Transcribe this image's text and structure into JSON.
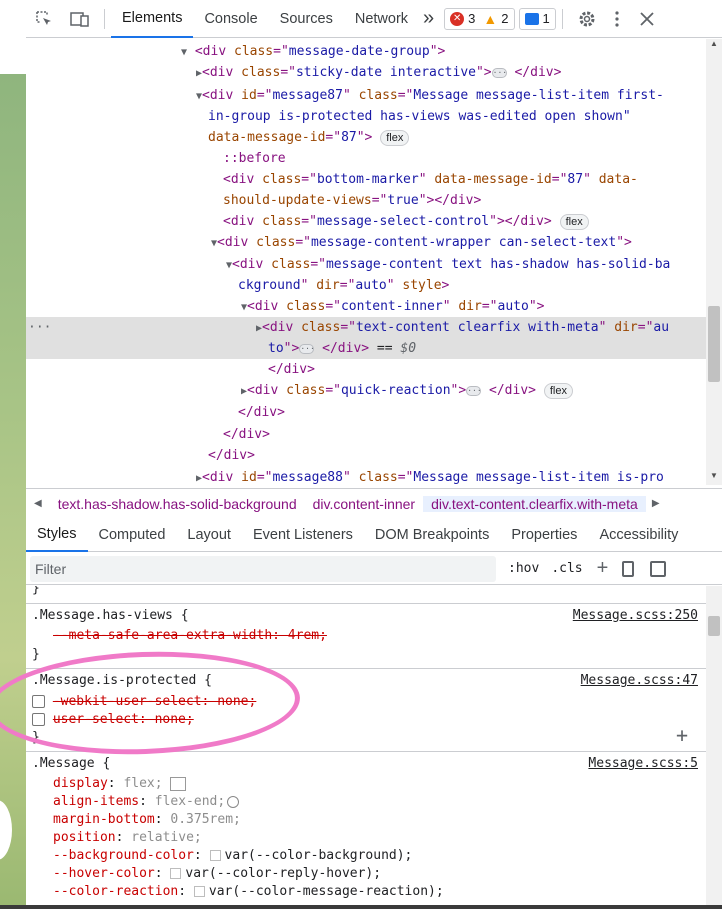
{
  "toolbar": {
    "tabs": [
      "Elements",
      "Console",
      "Sources",
      "Network"
    ],
    "more": "»",
    "errors": "3",
    "warnings": "2",
    "messages": "1"
  },
  "dom": {
    "l1": [
      "<div ",
      "class",
      "=\"",
      "message-date-group",
      "\">"
    ],
    "l2": [
      "<div ",
      "class",
      "=\"",
      "sticky-date interactive",
      "\">",
      "</div>"
    ],
    "l3a": [
      "<div ",
      "id",
      "=\"",
      "message87",
      "\" ",
      "class",
      "=\"",
      "Message message-list-item first-"
    ],
    "l3b": "in-group is-protected has-views was-edited open shown\"",
    "l3c": [
      "data-message-id",
      "=\"",
      "87",
      "\">"
    ],
    "flex": "flex",
    "before": "::before",
    "l5a": [
      "<div ",
      "class",
      "=\"",
      "bottom-marker",
      "\" ",
      "data-message-id",
      "=\"",
      "87",
      "\" ",
      "data-"
    ],
    "l5b": [
      "should-update-views",
      "=\"",
      "true",
      "\">",
      "</div>"
    ],
    "l6": [
      "<div ",
      "class",
      "=\"",
      "message-select-control",
      "\">",
      "</div>"
    ],
    "l7": [
      "<div ",
      "class",
      "=\"",
      "message-content-wrapper can-select-text",
      "\">"
    ],
    "l8a": [
      "<div ",
      "class",
      "=\"",
      "message-content text has-shadow has-solid-ba"
    ],
    "l8b": [
      "ckground",
      "\" ",
      "dir",
      "=\"",
      "auto",
      "\" ",
      "style",
      ">"
    ],
    "l9": [
      "<div ",
      "class",
      "=\"",
      "content-inner",
      "\" ",
      "dir",
      "=\"",
      "auto",
      "\">"
    ],
    "l10a": [
      "<div ",
      "class",
      "=\"",
      "text-content clearfix with-meta",
      "\" ",
      "dir",
      "=\"",
      "au"
    ],
    "l10b": [
      "to",
      "\">",
      "</div>",
      " == ",
      "$0"
    ],
    "close": "</div>",
    "l12": [
      "<div ",
      "class",
      "=\"",
      "quick-reaction",
      "\">",
      "</div>"
    ],
    "l17": [
      "<div ",
      "id",
      "=\"",
      "message88",
      "\" ",
      "class",
      "=\"",
      "Message message-list-item is-pro"
    ]
  },
  "breadcrumbs": [
    "text.has-shadow.has-solid-background",
    "div.content-inner",
    "div.text-content.clearfix.with-meta"
  ],
  "subtabs": [
    "Styles",
    "Computed",
    "Layout",
    "Event Listeners",
    "DOM Breakpoints",
    "Properties",
    "Accessibility"
  ],
  "filter": {
    "placeholder": "Filter",
    "hov": ":hov",
    "cls": ".cls"
  },
  "styles": {
    "brace": "}",
    "r1_sel": ".Message.has-views {",
    "r1_src": "Message.scss:250",
    "r1_p1": "--meta-safe-area-extra-width: 4rem;",
    "r2_sel": ".Message.is-protected {",
    "r2_src": "Message.scss:47",
    "r2_p1": "-webkit-user-select: none;",
    "r2_p2": "user-select: none;",
    "r3_sel": ".Message {",
    "r3_src": "Message.scss:5",
    "props": [
      {
        "name": "display",
        "value": "flex;"
      },
      {
        "name": "align-items",
        "value": "flex-end;"
      },
      {
        "name": "margin-bottom",
        "value": "0.375rem;"
      },
      {
        "name": "position",
        "value": "relative;"
      },
      {
        "name": "--background-color",
        "value": "var(--color-background);"
      },
      {
        "name": "--hover-color",
        "value": "var(--color-reply-hover);"
      },
      {
        "name": "--color-reaction",
        "value": "var(--color-message-reaction);"
      }
    ]
  },
  "colors": {
    "accent": "#1a73e8",
    "annotation": "#f07ac8"
  }
}
